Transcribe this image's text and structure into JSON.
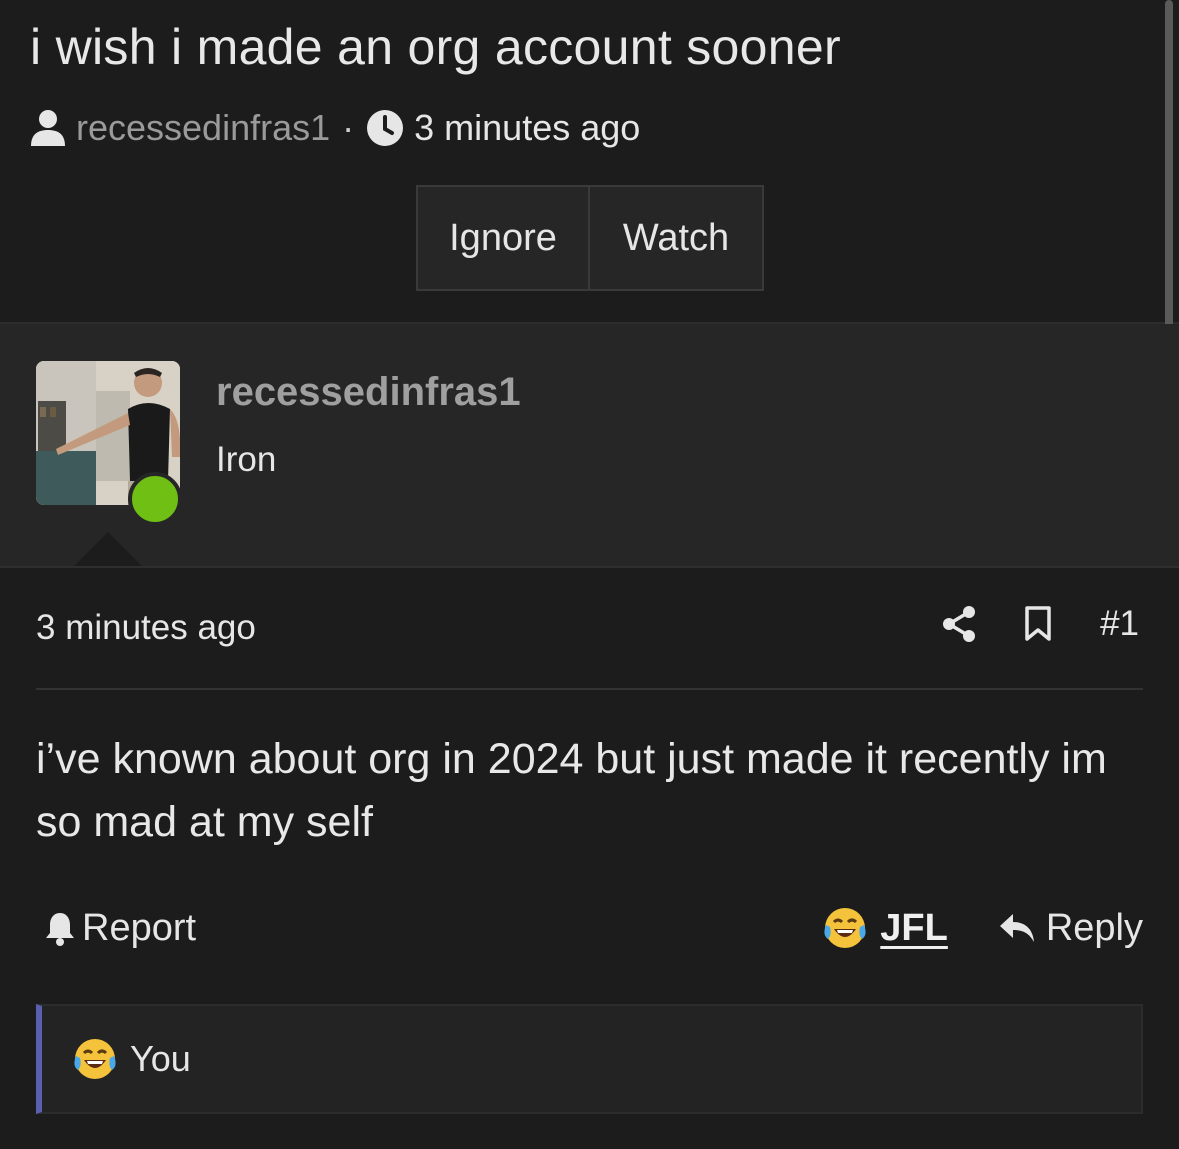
{
  "thread": {
    "title": "i wish i made an org account sooner",
    "author": "recessedinfras1",
    "separator": "·",
    "time": "3 minutes ago",
    "buttons": {
      "ignore": "Ignore",
      "watch": "Watch"
    }
  },
  "post": {
    "username": "recessedinfras1",
    "user_title": "Iron",
    "online": true,
    "time": "3 minutes ago",
    "number": "#1",
    "text": "i’ve known about org in 2024 but just made it recently im so mad at my self",
    "footer": {
      "report": "Report",
      "jfl": "JFL",
      "reply": "Reply"
    },
    "reactions": {
      "label": "You"
    }
  },
  "colors": {
    "background": "#1c1c1c",
    "panel": "#262626",
    "online_dot": "#6fbf14",
    "reaction_accent": "#5a5fb0"
  },
  "icons": [
    "user-icon",
    "clock-icon",
    "share-icon",
    "bookmark-icon",
    "bell-icon",
    "laughing-crying-emoji",
    "reply-arrow-icon"
  ]
}
